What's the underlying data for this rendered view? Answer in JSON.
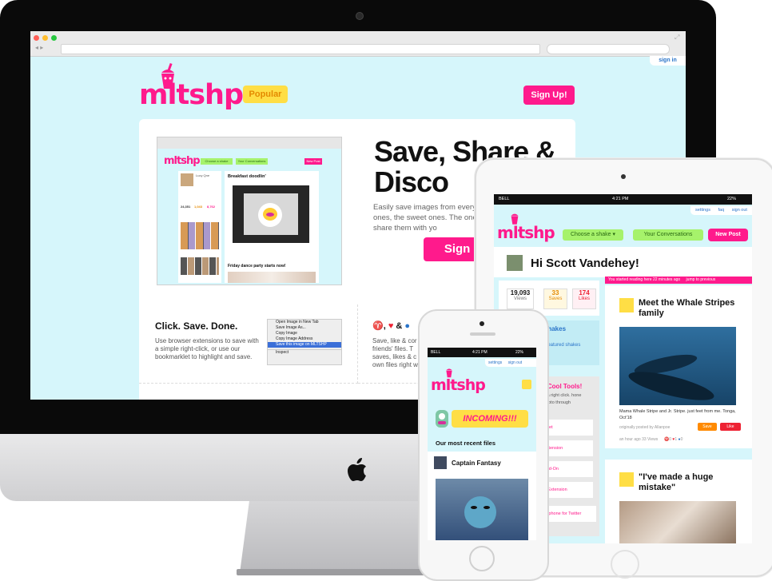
{
  "desktop": {
    "signin": "sign in",
    "popular": "Popular",
    "signup": "Sign Up!",
    "hero_title": "Save, Share & Disco",
    "hero_text": "Easily save images from everyw silly ones, the sweet ones. The ones. Then share them with yo",
    "hero_signup": "Sign me",
    "screenshot": {
      "choose": "Choose a shake",
      "conversations": "Your Conversations",
      "newpost": "New Post",
      "post1": "Breakfast doodlin'",
      "post2": "Friday dance party starts now!",
      "user": "Lucy Qne",
      "stats": [
        "24,351",
        "1,043",
        "8,762"
      ]
    },
    "feature1": {
      "title": "Click. Save. Done.",
      "text": "Use browser extensions to save with a simple right-click, or use our bookmarklet to highlight and save."
    },
    "context_menu": [
      "Open Image in New Tab",
      "Save Image As...",
      "Copy Image",
      "Copy Image Address",
      "Save this image on MLTSHP",
      "Inspect"
    ],
    "feature2": {
      "text": "Save, like & cor friends' files. T saves, likes & c own files right w"
    }
  },
  "ipad": {
    "status": {
      "carrier": "BELL",
      "time": "4:21 PM",
      "battery": "22%"
    },
    "links": [
      "settings",
      "faq",
      "sign out"
    ],
    "choose": "Choose a shake",
    "conversations": "Your Conversations",
    "newpost": "New Post",
    "greeting": "Hi Scott Vandehey!",
    "stats": [
      {
        "value": "19,093",
        "label": "Views"
      },
      {
        "value": "33",
        "label": "Saves"
      },
      {
        "value": "174",
        "label": "Likes"
      }
    ],
    "reading_banner": "You started reading here 22 minutes ago",
    "jump": "jump to previous",
    "post1_title": "Meet the Whale Stripes family",
    "post1_caption": "Mama Whale Stripe and Jr. Stripe. just feet from me. Tonga, Oct'18",
    "post1_meta": "originally posted by Allanpoe",
    "post1_time": "an hour ago",
    "post1_views": "33 Views",
    "post1_counts": [
      "0",
      "1",
      "0"
    ],
    "save": "Save",
    "like": "Like",
    "post2_title": "\"I've made a huge mistake\"",
    "side_shakes": "Shakes",
    "side_featured": "r featured shakes",
    "side_tools_title": "! Cool Tools!",
    "side_tools_text": "h a right click. hone photo through",
    "side_links": [
      "nklet",
      "Extension",
      "Add-On",
      "w Extension",
      "ur phone for Twitter"
    ]
  },
  "iphone": {
    "status": {
      "carrier": "BELL",
      "time": "4:21 PM",
      "battery": "22%"
    },
    "links": [
      "settings",
      "sign out"
    ],
    "incoming": "INCOMING!!!",
    "recent": "Our most recent files",
    "post_title": "Captain Fantasy"
  },
  "colors": {
    "pink": "#ff1a8c",
    "yellow": "#ffde45",
    "cyan": "#d6f6fb",
    "green": "#a6f26b"
  }
}
